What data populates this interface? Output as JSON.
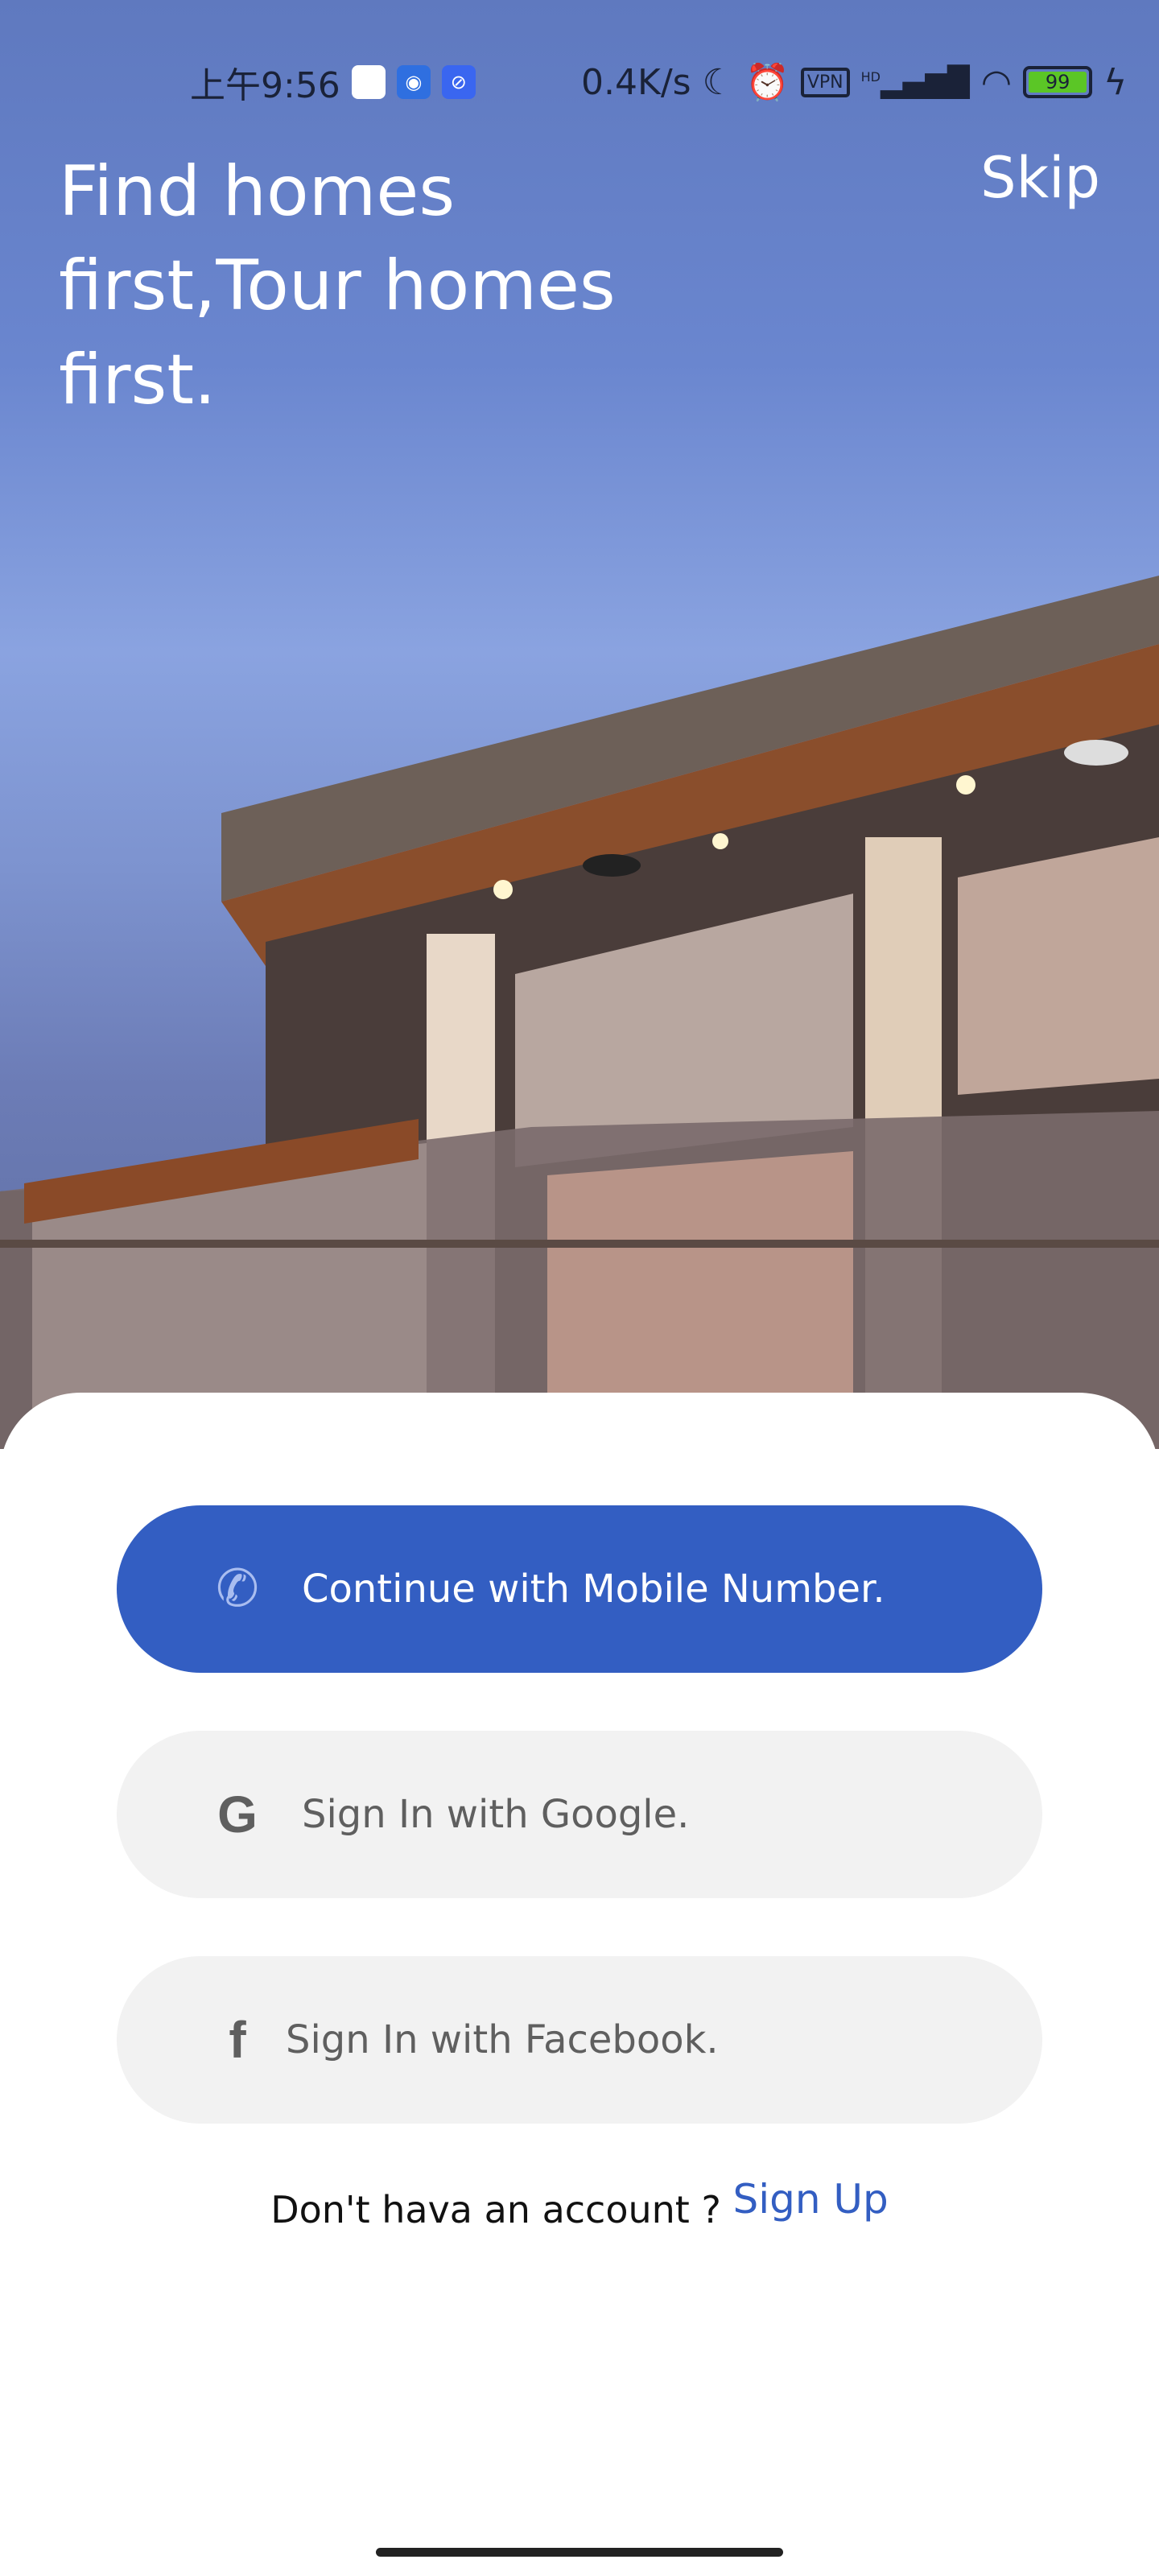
{
  "status_bar": {
    "time": "上午9:56",
    "net_speed": "0.4K/s",
    "vpn": "VPN",
    "hd": "HD",
    "battery": "99",
    "icons": [
      "notification-icon",
      "hotspot-icon",
      "app-icon",
      "moon-icon",
      "alarm-icon",
      "vpn-icon",
      "signal-icon",
      "wifi-icon",
      "battery-icon",
      "charging-icon"
    ]
  },
  "hero": {
    "headline": "Find homes first,Tour homes first.",
    "skip": "Skip"
  },
  "auth": {
    "mobile": {
      "label": "Continue with Mobile Number.",
      "icon": "phone-icon"
    },
    "google": {
      "label": "Sign In with Google.",
      "icon": "google-icon"
    },
    "facebook": {
      "label": "Sign In with Facebook.",
      "icon": "facebook-icon"
    },
    "no_account": "Don't hava an account ? ",
    "sign_up": "Sign Up"
  },
  "colors": {
    "primary": "#335ec2",
    "secondary_button": "#f2f2f2"
  }
}
